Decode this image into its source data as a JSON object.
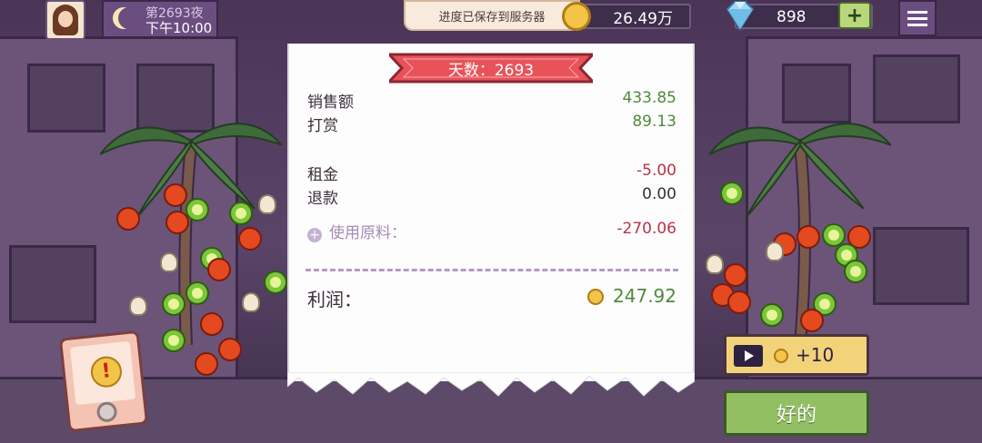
{
  "hud": {
    "night_label": "第2693夜",
    "time_label": "下午10:00",
    "toast": "进度已保存到服务器",
    "coins": "26.49万",
    "gems": "898",
    "add_gems": "+"
  },
  "receipt": {
    "day_banner": "天数：2693",
    "rows": [
      {
        "label": "销售额",
        "value": "433.85"
      },
      {
        "label": "打赏",
        "value": "89.13"
      },
      {
        "label": "租金",
        "value": "-5.00"
      },
      {
        "label": "退款",
        "value": "0.00"
      },
      {
        "label": "使用原料：",
        "value": "-270.06"
      }
    ],
    "profit_label": "利润：",
    "profit_value": "247.92"
  },
  "buttons": {
    "ad_reward": "+10",
    "ok": "好的"
  },
  "colors": {
    "positive": "#4f8a3c",
    "negative": "#b7344a",
    "banner": "#e8535a"
  }
}
